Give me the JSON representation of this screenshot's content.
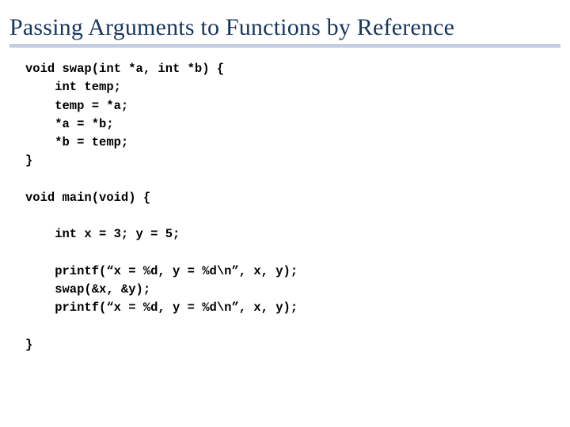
{
  "slide": {
    "title": "Passing Arguments to Functions by Reference",
    "code": "void swap(int *a, int *b) {\n    int temp;\n    temp = *a;\n    *a = *b;\n    *b = temp;\n}\n\nvoid main(void) {\n\n    int x = 3; y = 5;\n\n    printf(“x = %d, y = %d\\n”, x, y);\n    swap(&x, &y);\n    printf(“x = %d, y = %d\\n”, x, y);\n\n}"
  }
}
